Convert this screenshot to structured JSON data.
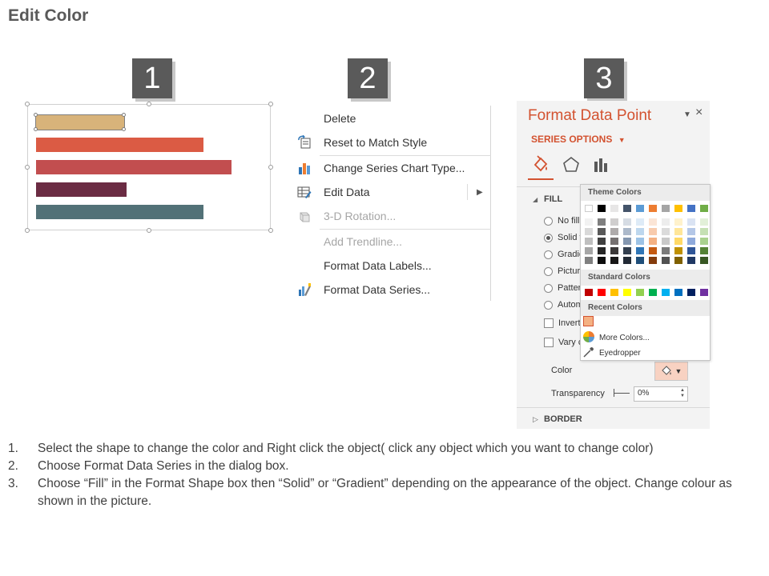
{
  "slide": {
    "title": "Edit Color"
  },
  "steps": [
    "1",
    "2",
    "3"
  ],
  "chart": {
    "bars": [
      {
        "color": "#d8b37a",
        "value": 0.38,
        "selected": true
      },
      {
        "color": "#db5b44",
        "value": 0.72
      },
      {
        "color": "#c24e4f",
        "value": 0.84
      },
      {
        "color": "#6b2c43",
        "value": 0.39
      },
      {
        "color": "#527177",
        "value": 0.72
      }
    ]
  },
  "context_menu": {
    "items": [
      {
        "label": "Delete",
        "icon": "none",
        "disabled": false
      },
      {
        "label": "Reset to Match Style",
        "icon": "reset-style-icon",
        "disabled": false
      },
      {
        "label": "Change Series Chart Type...",
        "icon": "chart-type-icon",
        "disabled": false
      },
      {
        "label": "Edit Data",
        "icon": "edit-data-icon",
        "disabled": false,
        "submenu": true
      },
      {
        "label": "3-D Rotation...",
        "icon": "rotation-3d-icon",
        "disabled": true
      },
      {
        "label": "Add Trendline...",
        "icon": "none",
        "disabled": true
      },
      {
        "label": "Format Data Labels...",
        "icon": "none",
        "disabled": false
      },
      {
        "label": "Format Data Series...",
        "icon": "format-series-icon",
        "disabled": false
      }
    ]
  },
  "format_pane": {
    "title": "Format Data Point",
    "series_options": "SERIES OPTIONS",
    "fill_section": "FILL",
    "fill_options": [
      "No fill",
      "Solid fill",
      "Gradient fill",
      "Picture or texture fill",
      "Pattern fill",
      "Automatic"
    ],
    "selected_fill": 1,
    "checkboxes": [
      "Invert if negative",
      "Vary colors by point"
    ],
    "color_label": "Color",
    "transparency_label": "Transparency",
    "transparency_value": "0%",
    "border_section": "BORDER",
    "accent_color": "#d35230"
  },
  "color_popup": {
    "theme_colors_label": "Theme Colors",
    "standard_colors_label": "Standard Colors",
    "recent_colors_label": "Recent Colors",
    "more_colors": "More Colors...",
    "eyedropper": "Eyedropper",
    "theme_columns": [
      [
        "#ffffff",
        "#f2f2f2",
        "#d9d9d9",
        "#bfbfbf",
        "#a6a6a6",
        "#808080"
      ],
      [
        "#000000",
        "#7f7f7f",
        "#595959",
        "#404040",
        "#262626",
        "#0d0d0d"
      ],
      [
        "#e7e6e6",
        "#d0cece",
        "#afabab",
        "#767171",
        "#3b3838",
        "#171616"
      ],
      [
        "#44546a",
        "#d6dce4",
        "#acb9ca",
        "#8497b0",
        "#333f4f",
        "#222a35"
      ],
      [
        "#5b9bd5",
        "#deebf7",
        "#bdd7ee",
        "#9dc3e6",
        "#2e75b6",
        "#1f4e79"
      ],
      [
        "#ed7d31",
        "#fbe5d6",
        "#f8cbad",
        "#f4b183",
        "#c55a11",
        "#843c0c"
      ],
      [
        "#a5a5a5",
        "#ededed",
        "#dbdbdb",
        "#c9c9c9",
        "#7b7b7b",
        "#525252"
      ],
      [
        "#ffc000",
        "#fff2cc",
        "#ffe699",
        "#ffd966",
        "#bf9000",
        "#7f6000"
      ],
      [
        "#4472c4",
        "#dae3f3",
        "#b4c7e7",
        "#8faadc",
        "#2f5597",
        "#203864"
      ],
      [
        "#70ad47",
        "#e2f0d9",
        "#c5e0b4",
        "#a9d18e",
        "#548235",
        "#385723"
      ]
    ],
    "standard": [
      "#c00000",
      "#ff0000",
      "#ffc000",
      "#ffff00",
      "#92d050",
      "#00b050",
      "#00b0f0",
      "#0070c0",
      "#002060",
      "#7030a0"
    ],
    "recent": "#f4b183"
  },
  "instructions": [
    {
      "num": "1.",
      "text": "Select the shape to change the color and Right click the object( click any object which you want to change color)"
    },
    {
      "num": "2.",
      "text": "Choose Format Data Series in the dialog box."
    },
    {
      "num": "3.",
      "text": "Choose “Fill” in the Format Shape box then  “Solid” or “Gradient” depending on the appearance of the object. Change colour as shown in the picture."
    }
  ]
}
